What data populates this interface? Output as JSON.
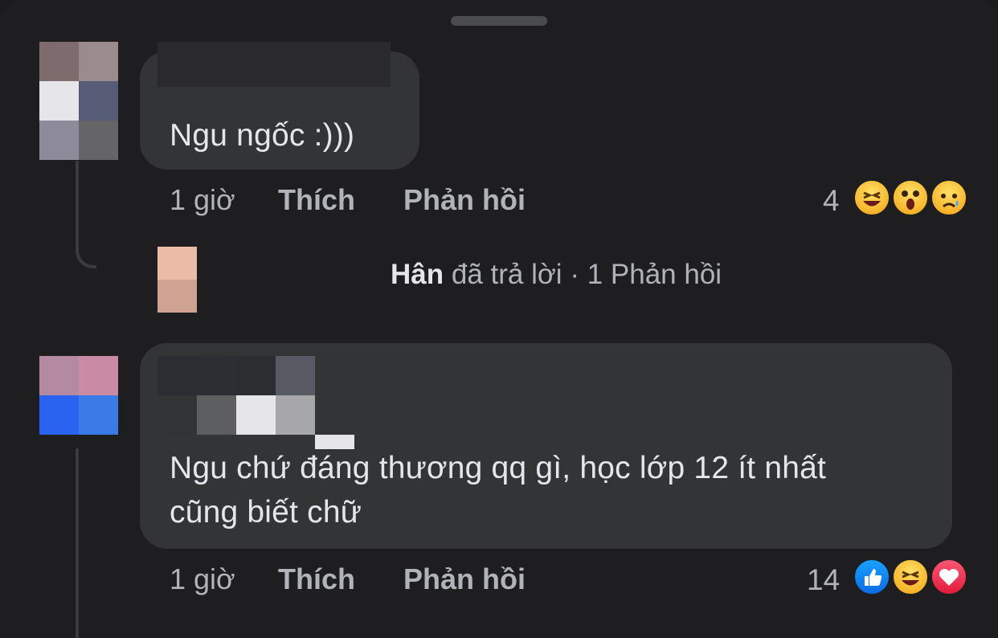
{
  "comments": [
    {
      "text": "Ngu ngốc :)))",
      "time": "1 giờ",
      "like_label": "Thích",
      "reply_label": "Phản hồi",
      "reaction_count": "4",
      "reactions": [
        "haha-reaction-icon",
        "wow-reaction-icon",
        "sad-reaction-icon"
      ],
      "avatar_colors": [
        "#7e6b6e",
        "#9a8c8d",
        "#e6e6ea",
        "#575c76",
        "#8d8b99",
        "#656568"
      ]
    },
    {
      "text": "Ngu chứ đáng thương qq gì, học lớp 12 ít nhất\ncũng biết chữ",
      "time": "1 giờ",
      "like_label": "Thích",
      "reply_label": "Phản hồi",
      "reaction_count": "14",
      "reactions": [
        "like-reaction-icon",
        "haha-reaction-icon",
        "love-reaction-icon"
      ],
      "avatar_colors": [
        "#b48aa3",
        "#c88aa4",
        "#2a63f0",
        "#3a7be8"
      ]
    }
  ],
  "reply_summary": {
    "name": "Hân",
    "action": "đã trả lời",
    "separator": "·",
    "count_label": "1 Phản hồi"
  }
}
